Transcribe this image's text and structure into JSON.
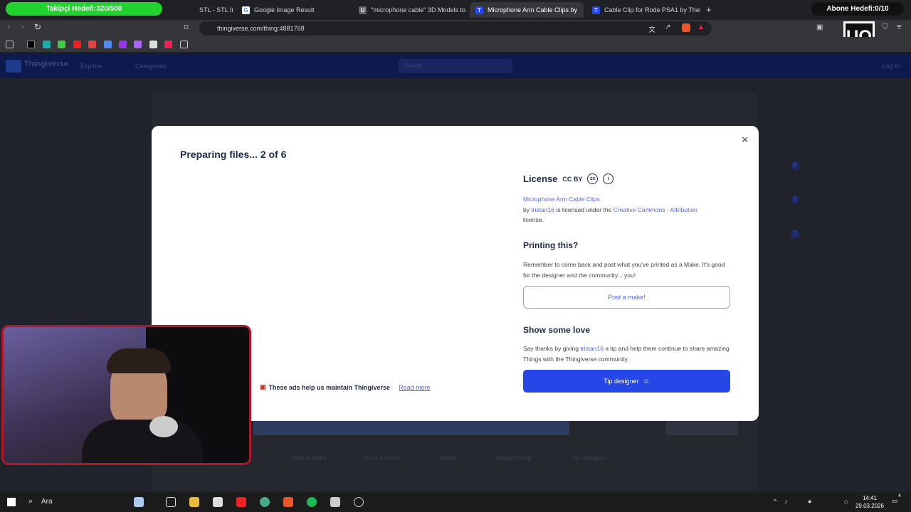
{
  "browser": {
    "follow_goal": "Takipçi Hedefi:320/500",
    "subscriber_goal": "Abone Hedefi:0/10",
    "tabs": [
      {
        "title": "STL - STL İn",
        "active": false
      },
      {
        "title": "Google Image Result",
        "active": false
      },
      {
        "title": "\"microphone cable\" 3D Models to Pr",
        "active": false
      },
      {
        "title": "Microphone Arm Cable Clips by",
        "active": true
      },
      {
        "title": "Cable Clip for Rode PSA1 by TheLife",
        "active": false
      }
    ],
    "new_tab_symbol": "+",
    "url": "thingiverse.com/thing:4881768"
  },
  "site": {
    "logo": "Thingiverse",
    "nav": [
      "Explore",
      "Categories"
    ],
    "search_placeholder": "Search",
    "login": "Log In",
    "bottom_actions": [
      "Post a make",
      "Post a remix",
      "Watch",
      "Report thing",
      "Tip designer"
    ],
    "side_counts": [
      "6",
      "3",
      "7"
    ]
  },
  "modal": {
    "title": "Preparing files... 2 of 6",
    "license_heading": "License",
    "license_badge": "CC BY",
    "thing_name": "Microphone Arm Cable Clips",
    "by": "by",
    "author": "tristan16",
    "licensed_under": "is licensed under the",
    "license_name": "Creative Commons - Attribution",
    "license_suffix": "license.",
    "printing_heading": "Printing this?",
    "printing_text": "Remember to come back and post what you've printed as a Make. It's good for the designer and the community... you!",
    "post_make_label": "Post a make!",
    "love_heading": "Show some love",
    "love_prefix": "Say thanks by giving",
    "love_suffix": "a tip and help them continue to share amazing Things with the Thingiverse community.",
    "tip_label": "Tip designer",
    "ads_text": "These ads help us maintain Thingiverse",
    "read_more": "Read more"
  },
  "taskbar": {
    "search_label": "Ara",
    "time": "14:41",
    "date": "29.03.2026",
    "notification_count": "4"
  }
}
